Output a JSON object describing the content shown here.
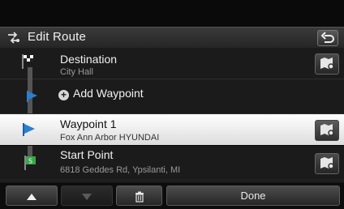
{
  "header": {
    "title": "Edit Route"
  },
  "rows": [
    {
      "primary": "Destination",
      "secondary": "City Hall"
    },
    {
      "primary": "Add Waypoint"
    },
    {
      "primary": "Waypoint 1",
      "secondary": "Fox Ann Arbor HYUNDAI"
    },
    {
      "primary": "Start Point",
      "secondary": "6818 Geddes Rd, Ypsilanti, MI"
    }
  ],
  "toolbar": {
    "done_label": "Done"
  },
  "colors": {
    "route_blue": "#2e5e86",
    "waypoint_blue": "#2a7fd0",
    "start_green": "#3aa54a"
  },
  "icons": [
    "edit-route-icon",
    "back-icon",
    "checkered-flag-icon",
    "waypoint-flag-icon",
    "start-flag-icon",
    "map-search-icon",
    "up-arrow-icon",
    "down-arrow-icon",
    "trash-icon",
    "plus-circle-icon"
  ]
}
